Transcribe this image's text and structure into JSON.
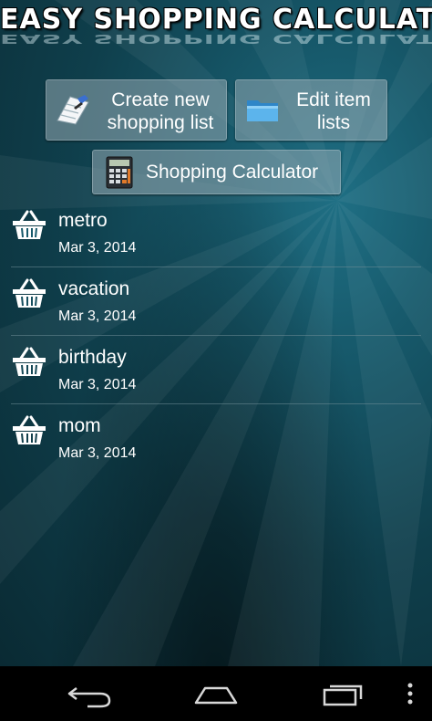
{
  "app": {
    "title": "EASY SHOPPING CALCULATOR"
  },
  "buttons": {
    "create": {
      "line1": "Create new",
      "line2": "shopping list",
      "icon": "notepad-pen-icon"
    },
    "edit": {
      "line1": "Edit item",
      "line2": "lists",
      "icon": "folder-icon"
    },
    "calculator": {
      "label": "Shopping Calculator",
      "icon": "calculator-icon"
    }
  },
  "lists": [
    {
      "name": "metro",
      "date": "Mar 3, 2014",
      "icon": "basket-icon"
    },
    {
      "name": "vacation",
      "date": "Mar 3, 2014",
      "icon": "basket-icon"
    },
    {
      "name": "birthday",
      "date": "Mar 3, 2014",
      "icon": "basket-icon"
    },
    {
      "name": "mom",
      "date": "Mar 3, 2014",
      "icon": "basket-icon"
    }
  ],
  "navbar": {
    "items": [
      "back-icon",
      "home-icon",
      "recent-apps-icon",
      "overflow-menu-icon"
    ]
  },
  "colors": {
    "background": "#175a6c",
    "button": "#96aab2",
    "navbar": "#000000"
  }
}
